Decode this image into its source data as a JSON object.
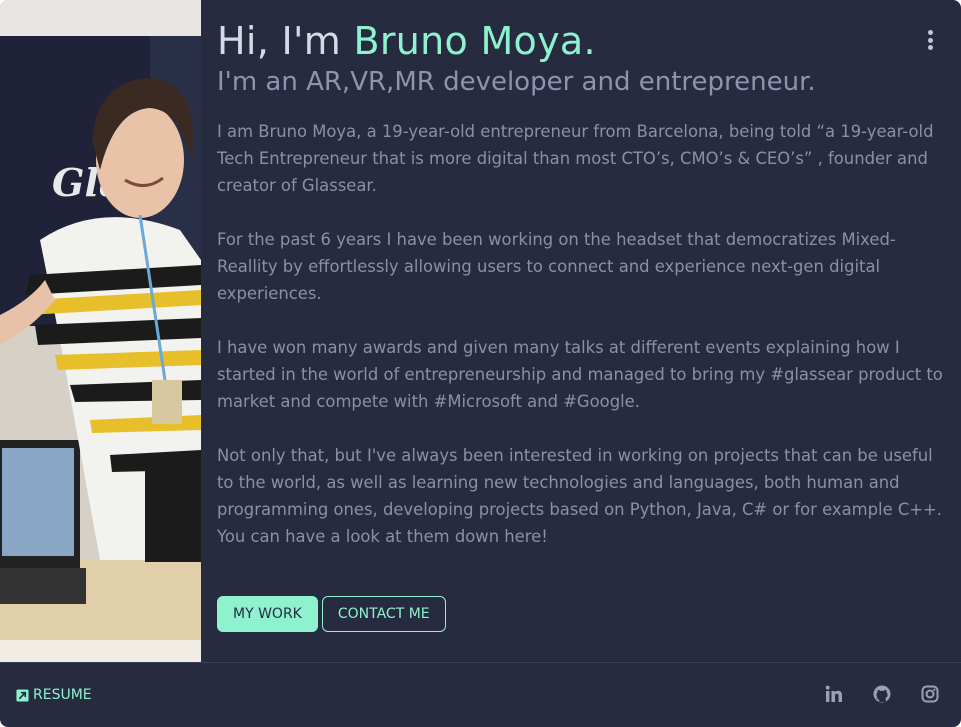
{
  "header": {
    "greeting": "Hi, I'm ",
    "name": "Bruno Moya.",
    "subtitle": "I'm an AR,VR,MR developer and entrepreneur."
  },
  "bio": [
    "I am Bruno Moya, a 19-year-old entrepreneur from Barcelona, being told “a 19-year-old Tech Entrepreneur that is more digital than most CTO’s, CMO’s & CEO’s” , founder and creator of Glassear.",
    "For the past 6 years I have been working on the headset that democratizes Mixed-Reallity by effortlessly allowing users to connect and experience next-gen digital experiences.",
    "I have won many awards and given many talks at different events explaining how I started in the world of entrepreneurship and managed to bring my #glassear product to market and compete with #Microsoft and #Google.",
    "Not only that, but I've always been interested in working on projects that can be useful to the world, as well as learning new technologies and languages, both human and programming ones, developing projects based on Python, Java, C# or for example C++. You can have a look at them down here!"
  ],
  "buttons": {
    "primary": "MY WORK",
    "secondary": "CONTACT ME"
  },
  "footer": {
    "resume": "RESUME",
    "resume_icon": "external-link-icon",
    "socials": [
      "linkedin-icon",
      "github-icon",
      "instagram-icon"
    ]
  },
  "menu_icon": "more-vertical-icon",
  "colors": {
    "background": "#262b40",
    "accent": "#8ff2cf",
    "text": "#8b90a9",
    "heading": "#d7d9e6"
  }
}
